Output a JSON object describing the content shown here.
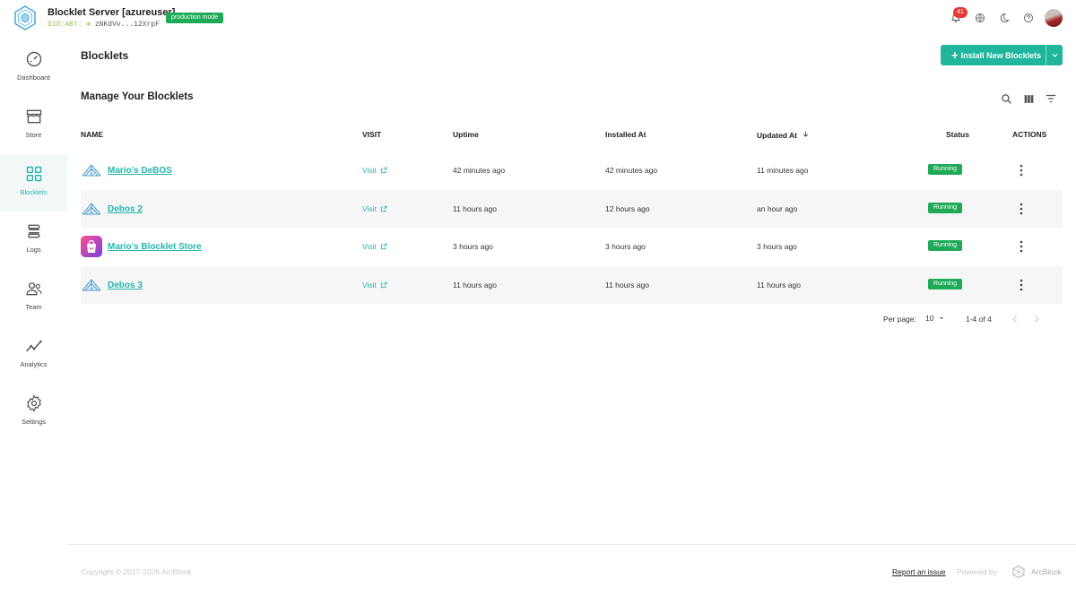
{
  "header": {
    "server_title": "Blocklet Server [azureuser]",
    "did_prefix": "DID:ABT:",
    "did_value": "zNKdVv...12XrpF",
    "mode_badge": "production mode",
    "notification_count": "41",
    "icons": [
      "bell-icon",
      "globe-icon",
      "moon-icon",
      "help-icon"
    ]
  },
  "sidebar": {
    "items": [
      {
        "label": "Dashboard",
        "icon": "dashboard-icon"
      },
      {
        "label": "Store",
        "icon": "store-icon"
      },
      {
        "label": "Blocklets",
        "icon": "blocklets-icon",
        "active": true
      },
      {
        "label": "Logs",
        "icon": "logs-icon"
      },
      {
        "label": "Team",
        "icon": "team-icon"
      },
      {
        "label": "Analytics",
        "icon": "analytics-icon"
      },
      {
        "label": "Settings",
        "icon": "settings-icon"
      }
    ]
  },
  "page": {
    "title": "Blocklets",
    "install_button": "Install New Blocklets",
    "section_title": "Manage Your Blocklets"
  },
  "table": {
    "columns": [
      "NAME",
      "VISIT",
      "Uptime",
      "Installed At",
      "Updated At",
      "Status",
      "ACTIONS"
    ],
    "rows": [
      {
        "name": "Mario's DeBOS",
        "visit": "Visit",
        "uptime": "42 minutes ago",
        "installed": "42 minutes ago",
        "updated": "11 minutes ago",
        "status": "Running",
        "icon": "debos-icon"
      },
      {
        "name": "Debos 2",
        "visit": "Visit",
        "uptime": "11 hours ago",
        "installed": "12 hours ago",
        "updated": "an hour ago",
        "status": "Running",
        "icon": "debos-icon"
      },
      {
        "name": "Mario's Blocklet Store",
        "visit": "Visit",
        "uptime": "3 hours ago",
        "installed": "3 hours ago",
        "updated": "3 hours ago",
        "status": "Running",
        "icon": "store-bag-icon"
      },
      {
        "name": "Debos 3",
        "visit": "Visit",
        "uptime": "11 hours ago",
        "installed": "11 hours ago",
        "updated": "11 hours ago",
        "status": "Running",
        "icon": "debos-icon"
      }
    ]
  },
  "pagination": {
    "per_page_label": "Per page:",
    "per_page_value": "10",
    "range": "1-4 of 4"
  },
  "footer": {
    "copyright": "Copyright © 2017-2026  ArcBlock",
    "report_link": "Report an issue",
    "powered_by": "Powered by",
    "brand": "ArcBlock"
  },
  "colors": {
    "accent": "#25b6ad",
    "button": "#1fb69c",
    "status_running": "#1faa58",
    "notification": "#e53935"
  }
}
